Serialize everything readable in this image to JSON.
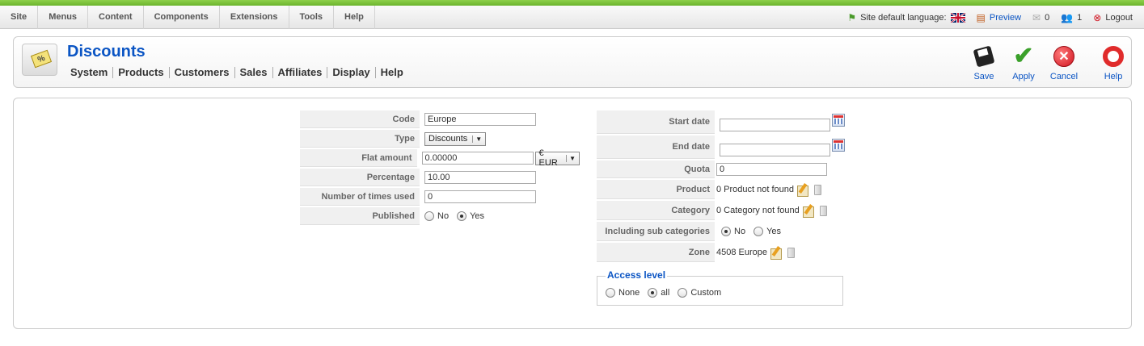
{
  "menu": {
    "items": [
      "Site",
      "Menus",
      "Content",
      "Components",
      "Extensions",
      "Tools",
      "Help"
    ]
  },
  "status": {
    "language_label": "Site default language:",
    "preview_label": "Preview",
    "messages_count": "0",
    "users_count": "1",
    "logout_label": "Logout"
  },
  "header": {
    "title": "Discounts",
    "submenu": [
      "System",
      "Products",
      "Customers",
      "Sales",
      "Affiliates",
      "Display",
      "Help"
    ]
  },
  "toolbar": {
    "save_label": "Save",
    "apply_label": "Apply",
    "cancel_label": "Cancel",
    "help_label": "Help"
  },
  "form_left": {
    "code_label": "Code",
    "code_value": "Europe",
    "type_label": "Type",
    "type_value": "Discounts",
    "flat_amount_label": "Flat amount",
    "flat_amount_value": "0.00000",
    "currency_value": "€ EUR",
    "percentage_label": "Percentage",
    "percentage_value": "10.00",
    "times_used_label": "Number of times used",
    "times_used_value": "0",
    "published_label": "Published",
    "published_no": "No",
    "published_yes": "Yes",
    "published_selected": "Yes"
  },
  "form_right": {
    "start_date_label": "Start date",
    "start_date_value": "",
    "end_date_label": "End date",
    "end_date_value": "",
    "quota_label": "Quota",
    "quota_value": "0",
    "product_label": "Product",
    "product_value": "0 Product not found",
    "category_label": "Category",
    "category_value": "0 Category not found",
    "subcat_label": "Including sub categories",
    "subcat_no": "No",
    "subcat_yes": "Yes",
    "subcat_selected": "No",
    "zone_label": "Zone",
    "zone_value": "4508 Europe"
  },
  "access": {
    "legend": "Access level",
    "none_label": "None",
    "all_label": "all",
    "custom_label": "Custom",
    "selected": "all"
  },
  "colors": {
    "brand_green": "#6cb42e",
    "link_blue": "#0b55c4"
  }
}
